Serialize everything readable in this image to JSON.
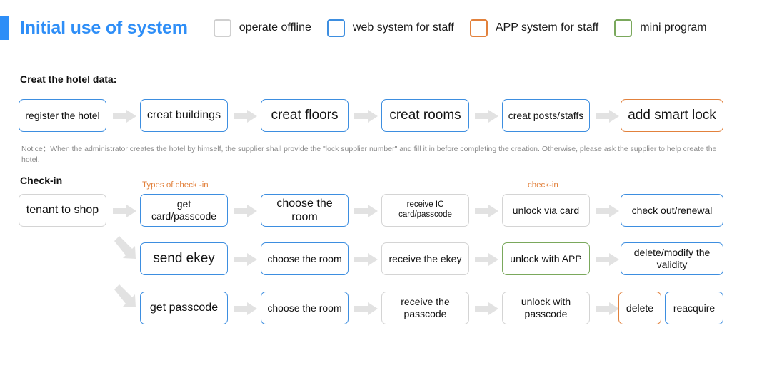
{
  "header": {
    "title": "Initial use of system",
    "legend": [
      {
        "label": "operate offline",
        "color": "#cfcfcf",
        "icon": "checkbox-icon"
      },
      {
        "label": "web system for staff",
        "color": "#3d8ee0",
        "icon": "checkbox-icon"
      },
      {
        "label": "APP system for staff",
        "color": "#e2813c",
        "icon": "checkbox-icon"
      },
      {
        "label": "mini program",
        "color": "#7aa85c",
        "icon": "checkbox-icon"
      }
    ]
  },
  "sections": {
    "hotel_data": {
      "title": "Creat the hotel data:",
      "steps": [
        {
          "label": "register the hotel",
          "style": "blue",
          "size": "fs-md"
        },
        {
          "label": "creat buildings",
          "style": "blue",
          "size": "fs-lg"
        },
        {
          "label": "creat floors",
          "style": "blue",
          "size": "fs-xl"
        },
        {
          "label": "creat rooms",
          "style": "blue",
          "size": "fs-xl"
        },
        {
          "label": "creat posts/staffs",
          "style": "blue",
          "size": "fs-md"
        },
        {
          "label": "add smart lock",
          "style": "orange",
          "size": "fs-xl"
        }
      ],
      "notice": "Notice：When the administrator creates the hotel by himself, the supplier shall provide the \"lock supplier number\" and fill it in before completing the creation. Otherwise, please ask the supplier to help create the hotel."
    },
    "checkin": {
      "title": "Check-in",
      "captions": [
        {
          "text": "Types of check -in"
        },
        {
          "text": "check-in"
        }
      ],
      "entry": {
        "label": "tenant to shop",
        "style": "gray",
        "size": "fs-lg"
      },
      "rows": [
        {
          "steps": [
            {
              "label": "get card/passcode",
              "style": "blue",
              "size": "fs-md"
            },
            {
              "label": "choose the room",
              "style": "blue",
              "size": "fs-lg"
            },
            {
              "label": "receive IC card/passcode",
              "style": "gray",
              "size": "fs-sm"
            },
            {
              "label": "unlock via card",
              "style": "gray",
              "size": "fs-md"
            },
            {
              "label": "check out/renewal",
              "style": "blue",
              "size": "fs-md"
            }
          ]
        },
        {
          "steps": [
            {
              "label": "send ekey",
              "style": "blue",
              "size": "fs-xl"
            },
            {
              "label": "choose the room",
              "style": "blue",
              "size": "fs-md"
            },
            {
              "label": "receive the ekey",
              "style": "gray",
              "size": "fs-md"
            },
            {
              "label": "unlock with APP",
              "style": "green",
              "size": "fs-md"
            },
            {
              "label": "delete/modify the validity",
              "style": "blue",
              "size": "fs-md"
            }
          ]
        },
        {
          "steps": [
            {
              "label": "get passcode",
              "style": "blue",
              "size": "fs-lg"
            },
            {
              "label": "choose the room",
              "style": "blue",
              "size": "fs-md"
            },
            {
              "label": "receive the passcode",
              "style": "gray",
              "size": "fs-md"
            },
            {
              "label": "unlock with passcode",
              "style": "gray",
              "size": "fs-md"
            },
            {
              "label": "delete",
              "style": "orange",
              "size": "fs-md"
            },
            {
              "label": "reacquire",
              "style": "blue",
              "size": "fs-md"
            }
          ]
        }
      ]
    }
  }
}
